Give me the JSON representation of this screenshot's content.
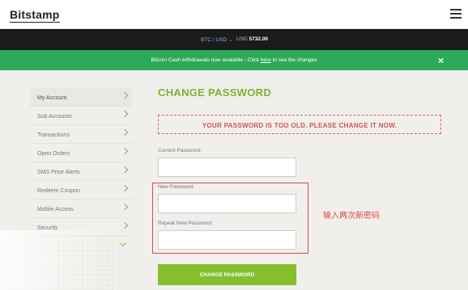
{
  "header": {
    "logo": "Bitstamp"
  },
  "price_bar": {
    "pair": "BTC / USD ⌄",
    "currency": "USD",
    "price": "5732.00"
  },
  "notice": {
    "text_before": "Bitcoin Cash withdrawals now available - Click ",
    "link": "here",
    "text_after": " to see the changes",
    "close": "×"
  },
  "sidebar": {
    "items": [
      {
        "label": "My Account"
      },
      {
        "label": "Sub Accounts"
      },
      {
        "label": "Transactions"
      },
      {
        "label": "Open Orders"
      },
      {
        "label": "SMS Price Alerts"
      },
      {
        "label": "Redeem Coupon"
      },
      {
        "label": "Mobile Access"
      },
      {
        "label": "Security"
      }
    ]
  },
  "main": {
    "title": "CHANGE PASSWORD",
    "warning": "YOUR PASSWORD IS TOO OLD. PLEASE CHANGE IT NOW.",
    "current_label": "Current Password:",
    "new_label": "New Password:",
    "repeat_label": "Repeat New Password:",
    "current_value": "",
    "new_value": "",
    "repeat_value": "",
    "submit": "CHANGE PASSWORD"
  },
  "annotation": {
    "text": "输入两次新密码",
    "color": "#e04848"
  },
  "colors": {
    "accent_green": "#7ab52d",
    "notice_green": "#2daa59",
    "button_green": "#85bf2e",
    "warning_red": "#d05555"
  }
}
